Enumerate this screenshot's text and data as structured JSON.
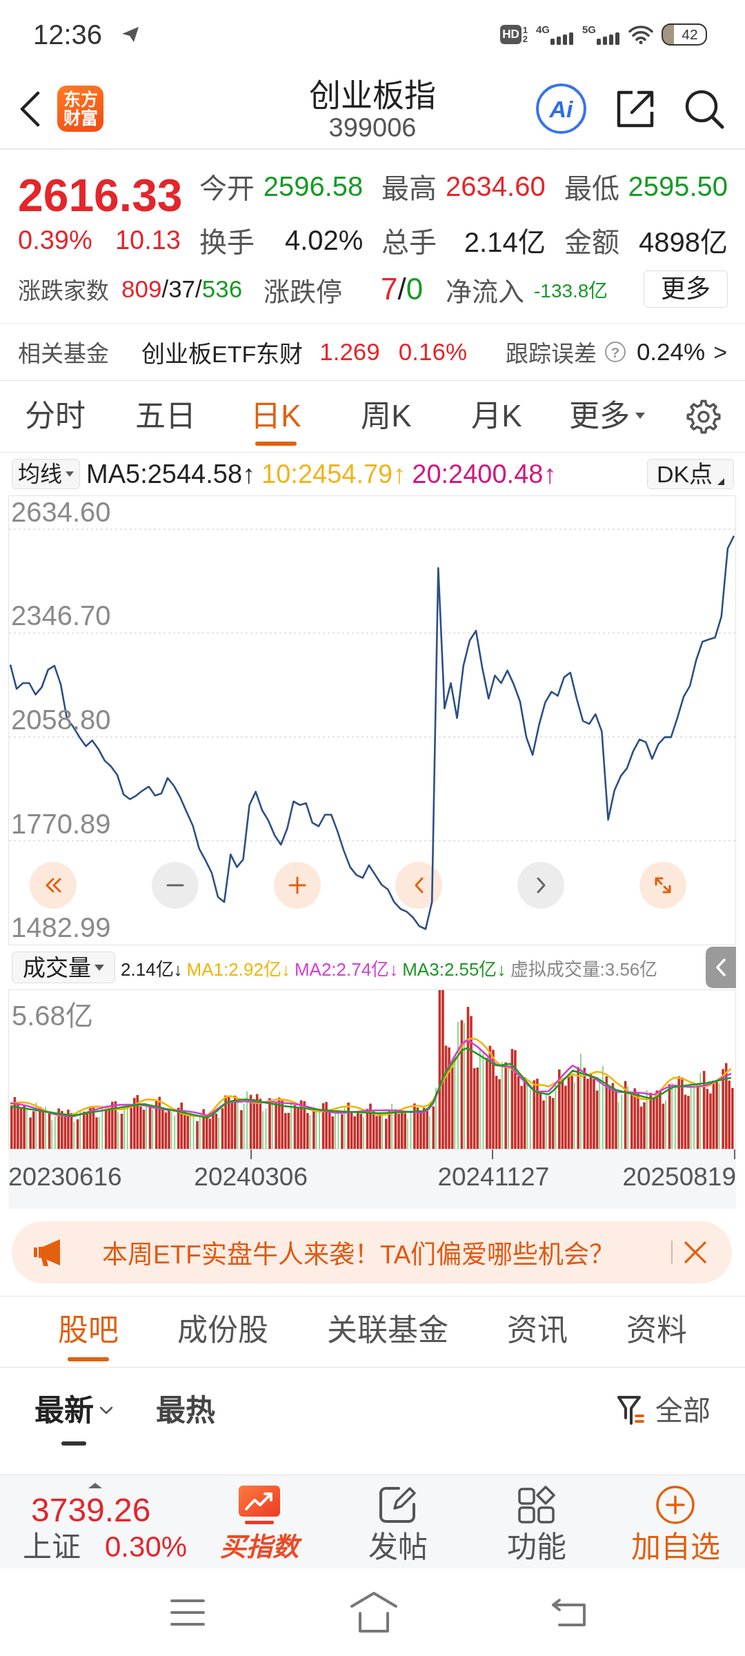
{
  "status_bar": {
    "time": "12:36",
    "hd": {
      "label": "HD",
      "sup": "1",
      "sub": "2"
    },
    "networks": [
      "4G",
      "5G"
    ],
    "battery": "42"
  },
  "header": {
    "logo": [
      "东方",
      "财富"
    ],
    "title": "创业板指",
    "code": "399006",
    "ai_label": "Ai"
  },
  "quote": {
    "price": "2616.33",
    "change_pct": "0.39%",
    "change": "10.13",
    "color": "#e3262b",
    "stats": [
      {
        "label": "今开",
        "value": "2596.58",
        "color": "#169a25"
      },
      {
        "label": "最高",
        "value": "2634.60",
        "color": "#e3262b"
      },
      {
        "label": "最低",
        "value": "2595.50",
        "color": "#169a25"
      },
      {
        "label": "换手",
        "value": "4.02%",
        "color": "#222222"
      },
      {
        "label": "总手",
        "value": "2.14亿",
        "color": "#222222"
      },
      {
        "label": "金额",
        "value": "4898亿",
        "color": "#222222"
      }
    ],
    "breadth": {
      "label": "涨跌家数",
      "parts": [
        {
          "text": "809",
          "color": "#e3262b"
        },
        {
          "text": "/",
          "color": "#222222"
        },
        {
          "text": "37",
          "color": "#222222"
        },
        {
          "text": "/",
          "color": "#222222"
        },
        {
          "text": "536",
          "color": "#169a25"
        }
      ]
    },
    "limit": {
      "label": "涨跌停",
      "parts": [
        {
          "text": "7",
          "color": "#e3262b"
        },
        {
          "text": "/",
          "color": "#222222"
        },
        {
          "text": "0",
          "color": "#169a25"
        }
      ]
    },
    "net_inflow": {
      "label": "净流入",
      "value": "-133.8亿",
      "color": "#169a25"
    },
    "more_button": "更多"
  },
  "related_fund": {
    "label": "相关基金",
    "name": "创业板ETF东财",
    "price": "1.269",
    "change_pct": "0.16%",
    "color": "#e3262b",
    "tracking_label": "跟踪误差",
    "help": "?",
    "tracking_value": "0.24%",
    "more": ">"
  },
  "chart_tabs": [
    {
      "label": "分时",
      "selected": false,
      "dropdown": false
    },
    {
      "label": "五日",
      "selected": false,
      "dropdown": false
    },
    {
      "label": "日K",
      "selected": true,
      "dropdown": false
    },
    {
      "label": "周K",
      "selected": false,
      "dropdown": false
    },
    {
      "label": "月K",
      "selected": false,
      "dropdown": false
    },
    {
      "label": "更多",
      "selected": false,
      "dropdown": true
    }
  ],
  "indicators": {
    "selector": "均线",
    "items": [
      {
        "text": "MA5:2544.58↑",
        "color": "#222222"
      },
      {
        "text": "10:2454.79↑",
        "color": "#f2b31b"
      },
      {
        "text": "20:2400.48↑",
        "color": "#d0187f"
      }
    ],
    "dk_button": "DK点"
  },
  "price_chart": {
    "chart_data": {
      "type": "line",
      "grid": true,
      "ylim": [
        1482.99,
        2634.6
      ],
      "yticks": [
        {
          "value": 2634.6,
          "label": "2634.60"
        },
        {
          "value": 2346.7,
          "label": "2346.70"
        },
        {
          "value": 2058.8,
          "label": "2058.80"
        },
        {
          "value": 1770.89,
          "label": "1770.89"
        },
        {
          "value": 1482.99,
          "label": "1482.99"
        }
      ],
      "values": [
        2259,
        2192,
        2208,
        2208,
        2176,
        2197,
        2245,
        2256,
        2205,
        2109,
        2087,
        2058,
        2033,
        2049,
        2025,
        1993,
        1977,
        1953,
        1899,
        1886,
        1896,
        1910,
        1921,
        1896,
        1902,
        1945,
        1923,
        1891,
        1851,
        1813,
        1749,
        1717,
        1682,
        1615,
        1601,
        1733,
        1698,
        1719,
        1870,
        1907,
        1856,
        1827,
        1786,
        1760,
        1805,
        1880,
        1870,
        1875,
        1821,
        1811,
        1843,
        1843,
        1797,
        1743,
        1698,
        1676,
        1668,
        1703,
        1676,
        1649,
        1636,
        1601,
        1582,
        1574,
        1558,
        1534,
        1526,
        1601,
        2527,
        2138,
        2208,
        2111,
        2256,
        2326,
        2353,
        2251,
        2165,
        2229,
        2208,
        2243,
        2205,
        2157,
        2058,
        2009,
        2090,
        2154,
        2184,
        2173,
        2224,
        2237,
        2165,
        2103,
        2095,
        2122,
        2074,
        1829,
        1910,
        1950,
        1972,
        2020,
        2052,
        2044,
        1998,
        2039,
        2058,
        2058,
        2111,
        2170,
        2200,
        2272,
        2323,
        2329,
        2334,
        2393,
        2581,
        2616
      ]
    },
    "controls": [
      {
        "kind": "rewind",
        "disabled": false
      },
      {
        "kind": "zoom_out",
        "disabled": true
      },
      {
        "kind": "zoom_in",
        "disabled": false
      },
      {
        "kind": "prev",
        "disabled": false
      },
      {
        "kind": "next",
        "disabled": true
      },
      {
        "kind": "fullscreen",
        "disabled": false
      }
    ]
  },
  "volume": {
    "selector": "成交量",
    "items": [
      {
        "text": "2.14亿↓",
        "color": "#222222"
      },
      {
        "text": "MA1:2.92亿↓",
        "color": "#f2b400"
      },
      {
        "text": "MA2:2.74亿↓",
        "color": "#d23fd2"
      },
      {
        "text": "MA3:2.55亿↓",
        "color": "#1e9622"
      },
      {
        "text": "虚拟成交量:3.56亿",
        "color": "#888888"
      }
    ],
    "max_label": "5.68亿",
    "dates": [
      "20230616",
      "20240306",
      "20241127",
      "20250819"
    ]
  },
  "banner": {
    "text": "本周ETF实盘牛人来袭！TA们偏爱哪些机会？"
  },
  "section_tabs": [
    {
      "label": "股吧",
      "selected": true
    },
    {
      "label": "成份股",
      "selected": false
    },
    {
      "label": "关联基金",
      "selected": false
    },
    {
      "label": "资讯",
      "selected": false
    },
    {
      "label": "资料",
      "selected": false
    }
  ],
  "sort": {
    "options": [
      {
        "label": "最新",
        "selected": true,
        "dropdown": true
      },
      {
        "label": "最热",
        "selected": false,
        "dropdown": false
      }
    ],
    "filter": "全部"
  },
  "bottom_bar": {
    "index": {
      "value": "3739.26",
      "name": "上证",
      "change_pct": "0.30%",
      "color": "#e3262b"
    },
    "actions": [
      {
        "kind": "buy",
        "label": "买指数"
      },
      {
        "kind": "post",
        "label": "发帖"
      },
      {
        "kind": "functions",
        "label": "功能"
      },
      {
        "kind": "watch",
        "label": "加自选"
      }
    ]
  }
}
